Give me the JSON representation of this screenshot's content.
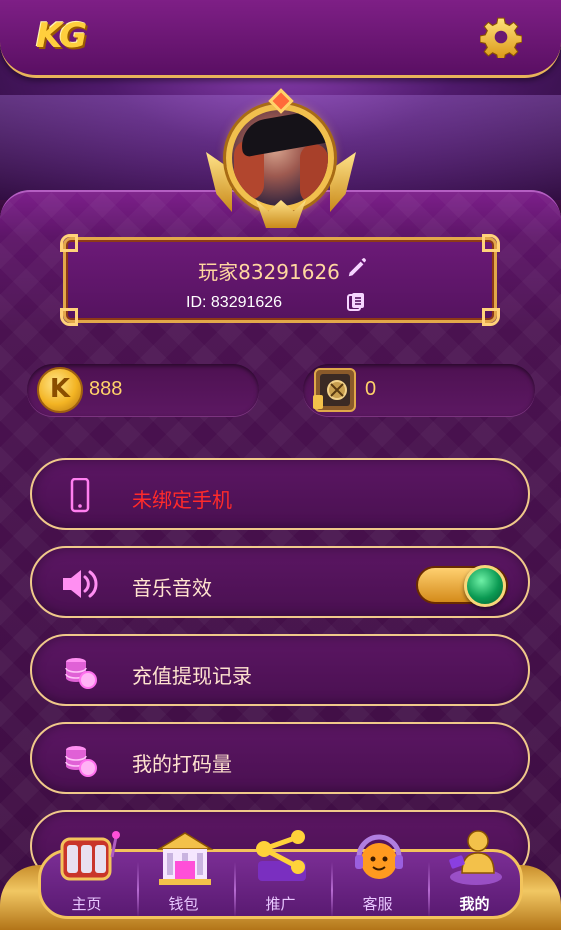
{
  "header": {
    "logo_text": "KG",
    "settings_icon": "gear-icon"
  },
  "profile": {
    "player_name": "玩家83291626",
    "player_id": "ID: 83291626",
    "edit_icon": "pencil-icon",
    "copy_icon": "copy-icon"
  },
  "balances": {
    "coins": "888",
    "safe": "0"
  },
  "menu": {
    "items": [
      {
        "label": "未绑定手机",
        "icon": "phone-icon"
      },
      {
        "label": "音乐音效",
        "icon": "speaker-icon",
        "toggle_on": true
      },
      {
        "label": "充值提现记录",
        "icon": "coins-stack-icon"
      },
      {
        "label": "我的打码量",
        "icon": "coins-stack-icon"
      }
    ]
  },
  "nav": {
    "items": [
      {
        "label": "主页",
        "icon": "slot-machine-icon"
      },
      {
        "label": "钱包",
        "icon": "bank-icon"
      },
      {
        "label": "推广",
        "icon": "share-icon"
      },
      {
        "label": "客服",
        "icon": "support-agent-icon"
      },
      {
        "label": "我的",
        "icon": "profile-icon",
        "active": true
      }
    ]
  },
  "colors": {
    "accent_gold": "#f0c98a",
    "warning_red": "#ff2a2a",
    "panel_purple": "#5b1663"
  }
}
